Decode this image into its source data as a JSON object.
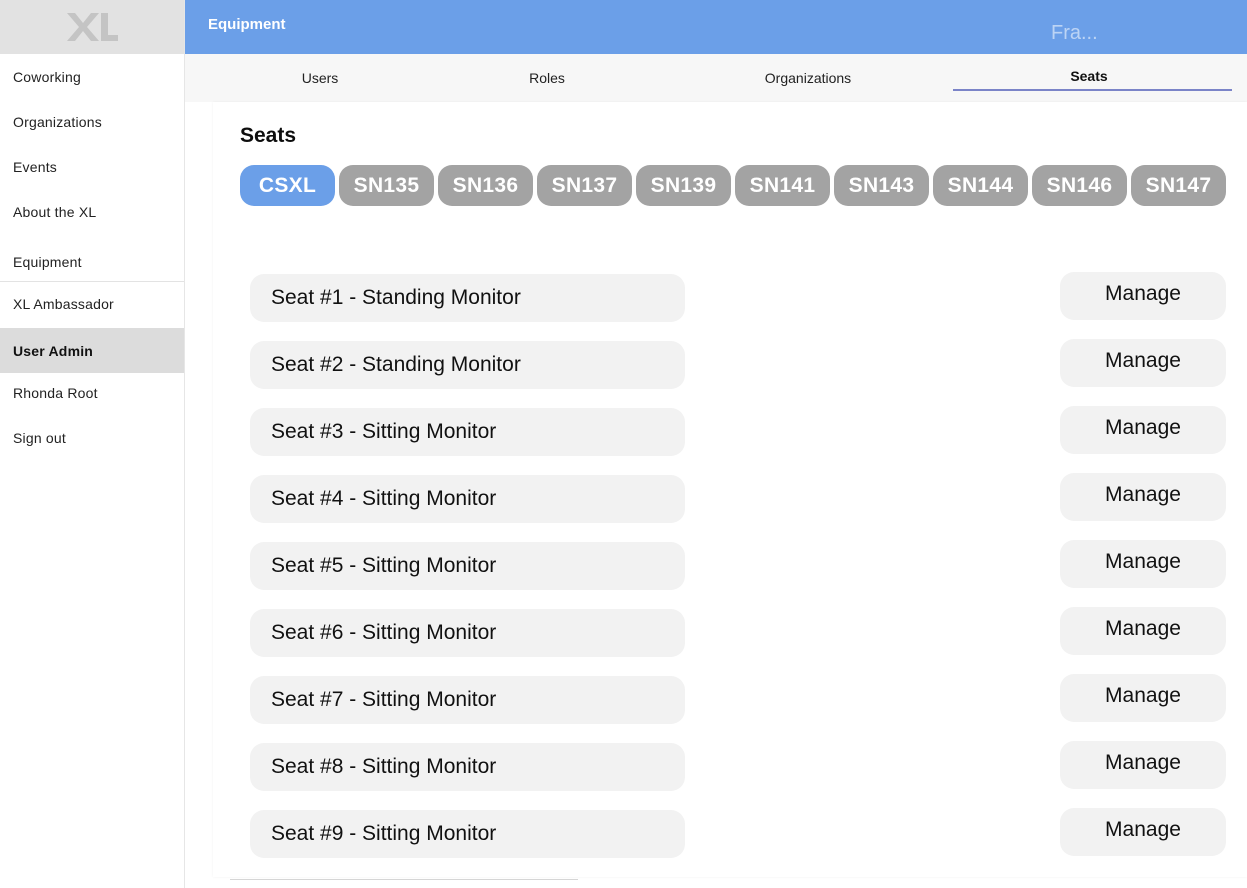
{
  "logo": {
    "text": "XL"
  },
  "sidebar": {
    "items": [
      {
        "label": "Coworking"
      },
      {
        "label": "Organizations"
      },
      {
        "label": "Events"
      },
      {
        "label": "About the XL"
      },
      {
        "label": "Equipment"
      },
      {
        "label": "XL Ambassador"
      },
      {
        "label": "User Admin"
      },
      {
        "label": "Rhonda Root"
      },
      {
        "label": "Sign out"
      }
    ]
  },
  "header": {
    "title": "Equipment",
    "ghost_text": "Fra..."
  },
  "tabs": [
    {
      "label": "Users"
    },
    {
      "label": "Roles"
    },
    {
      "label": "Organizations"
    },
    {
      "label": "Seats"
    }
  ],
  "main": {
    "title": "Seats",
    "rooms": [
      "CSXL",
      "SN135",
      "SN136",
      "SN137",
      "SN139",
      "SN141",
      "SN143",
      "SN144",
      "SN146",
      "SN147"
    ],
    "selected_room": "CSXL",
    "seats": [
      {
        "name": "Seat #1 - Standing Monitor"
      },
      {
        "name": "Seat #2 - Standing Monitor"
      },
      {
        "name": "Seat #3 - Sitting Monitor"
      },
      {
        "name": "Seat #4 - Sitting Monitor"
      },
      {
        "name": "Seat #5 - Sitting Monitor"
      },
      {
        "name": "Seat #6 - Sitting Monitor"
      },
      {
        "name": "Seat #7 - Sitting Monitor"
      },
      {
        "name": "Seat #8 - Sitting Monitor"
      },
      {
        "name": "Seat #9 - Sitting Monitor"
      }
    ],
    "manage_label": "Manage"
  },
  "colors": {
    "accent": "#6b9fe8",
    "chip_inactive": "#a3a3a3",
    "row_bg": "#f2f2f2",
    "active_nav_bg": "#dcdcdc",
    "tab_underline": "#7b84c8"
  }
}
